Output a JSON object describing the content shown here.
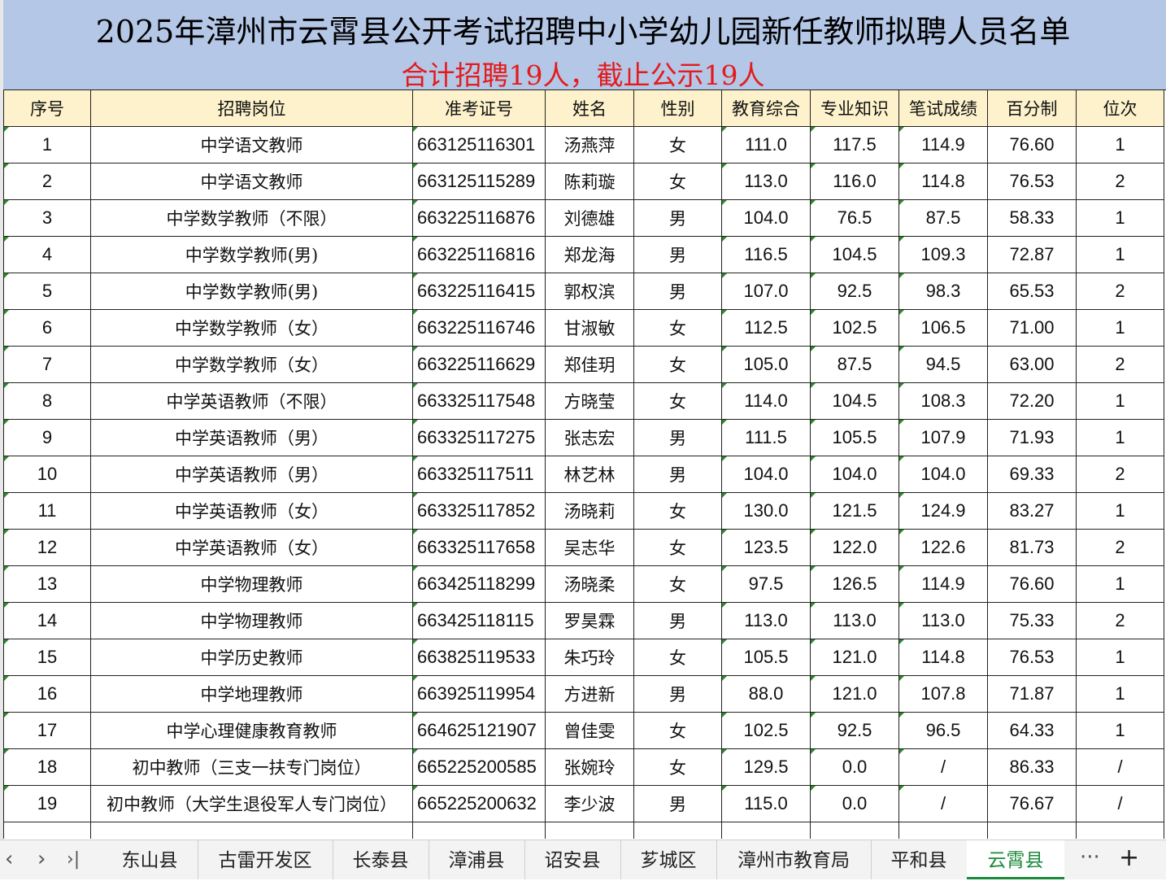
{
  "title": "2025年漳州市云霄县公开考试招聘中小学幼儿园新任教师拟聘人员名单",
  "subtitle": "合计招聘19人，截止公示19人",
  "headers": [
    "序号",
    "招聘岗位",
    "准考证号",
    "姓名",
    "性别",
    "教育综合",
    "专业知识",
    "笔试成绩",
    "百分制",
    "位次"
  ],
  "rows": [
    [
      "1",
      "中学语文教师",
      "663125116301",
      "汤燕萍",
      "女",
      "111.0",
      "117.5",
      "114.9",
      "76.60",
      "1"
    ],
    [
      "2",
      "中学语文教师",
      "663125115289",
      "陈莉璇",
      "女",
      "113.0",
      "116.0",
      "114.8",
      "76.53",
      "2"
    ],
    [
      "3",
      "中学数学教师（不限）",
      "663225116876",
      "刘德雄",
      "男",
      "104.0",
      "76.5",
      "87.5",
      "58.33",
      "1"
    ],
    [
      "4",
      "中学数学教师(男)",
      "663225116816",
      "郑龙海",
      "男",
      "116.5",
      "104.5",
      "109.3",
      "72.87",
      "1"
    ],
    [
      "5",
      "中学数学教师(男)",
      "663225116415",
      "郭权滨",
      "男",
      "107.0",
      "92.5",
      "98.3",
      "65.53",
      "2"
    ],
    [
      "6",
      "中学数学教师（女）",
      "663225116746",
      "甘淑敏",
      "女",
      "112.5",
      "102.5",
      "106.5",
      "71.00",
      "1"
    ],
    [
      "7",
      "中学数学教师（女）",
      "663225116629",
      "郑佳玥",
      "女",
      "105.0",
      "87.5",
      "94.5",
      "63.00",
      "2"
    ],
    [
      "8",
      "中学英语教师（不限）",
      "663325117548",
      "方晓莹",
      "女",
      "114.0",
      "104.5",
      "108.3",
      "72.20",
      "1"
    ],
    [
      "9",
      "中学英语教师（男）",
      "663325117275",
      "张志宏",
      "男",
      "111.5",
      "105.5",
      "107.9",
      "71.93",
      "1"
    ],
    [
      "10",
      "中学英语教师（男）",
      "663325117511",
      "林艺林",
      "男",
      "104.0",
      "104.0",
      "104.0",
      "69.33",
      "2"
    ],
    [
      "11",
      "中学英语教师（女）",
      "663325117852",
      "汤晓莉",
      "女",
      "130.0",
      "121.5",
      "124.9",
      "83.27",
      "1"
    ],
    [
      "12",
      "中学英语教师（女）",
      "663325117658",
      "吴志华",
      "女",
      "123.5",
      "122.0",
      "122.6",
      "81.73",
      "2"
    ],
    [
      "13",
      "中学物理教师",
      "663425118299",
      "汤晓柔",
      "女",
      "97.5",
      "126.5",
      "114.9",
      "76.60",
      "1"
    ],
    [
      "14",
      "中学物理教师",
      "663425118115",
      "罗昊霖",
      "男",
      "113.0",
      "113.0",
      "113.0",
      "75.33",
      "2"
    ],
    [
      "15",
      "中学历史教师",
      "663825119533",
      "朱巧玲",
      "女",
      "105.5",
      "121.0",
      "114.8",
      "76.53",
      "1"
    ],
    [
      "16",
      "中学地理教师",
      "663925119954",
      "方进新",
      "男",
      "88.0",
      "121.0",
      "107.8",
      "71.87",
      "1"
    ],
    [
      "17",
      "中学心理健康教育教师",
      "664625121907",
      "曾佳雯",
      "女",
      "102.5",
      "92.5",
      "96.5",
      "64.33",
      "1"
    ],
    [
      "18",
      "初中教师（三支一扶专门岗位）",
      "665225200585",
      "张婉玲",
      "女",
      "129.5",
      "0.0",
      "/",
      "86.33",
      "/"
    ],
    [
      "19",
      "初中教师（大学生退役军人专门岗位）",
      "665225200632",
      "李少波",
      "男",
      "115.0",
      "0.0",
      "/",
      "76.67",
      "/"
    ]
  ],
  "nav": {
    "prev": "‹",
    "next": "›",
    "last": "›|",
    "more": "···",
    "add": "+"
  },
  "tabs": [
    "东山县",
    "古雷开发区",
    "长泰县",
    "漳浦县",
    "诏安县",
    "芗城区",
    "漳州市教育局",
    "平和县",
    "云霄县"
  ],
  "active_tab": "云霄县",
  "colors": {
    "header_bg": "#b4c7e7",
    "subtitle": "#e41b1b",
    "col_header_bg": "#fdf2cb",
    "active_tab": "#1c8a3c"
  }
}
